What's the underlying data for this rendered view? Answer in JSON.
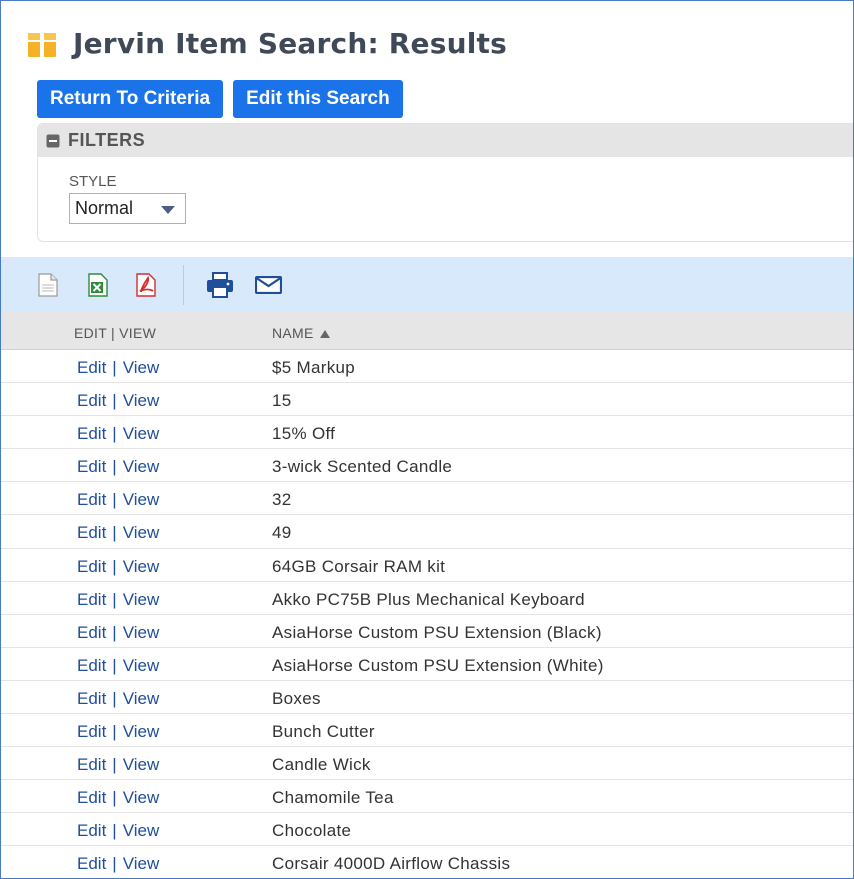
{
  "page": {
    "title": "Jervin Item Search: Results",
    "buttons": {
      "return_to_criteria": "Return To Criteria",
      "edit_this_search": "Edit this Search"
    }
  },
  "filters": {
    "label": "FILTERS",
    "style_label": "STYLE",
    "style_value": "Normal"
  },
  "toolbar": {
    "icons": [
      "export-csv-icon",
      "export-excel-icon",
      "export-pdf-icon",
      "print-icon",
      "email-icon"
    ]
  },
  "table": {
    "columns": {
      "edit_view": "EDIT | VIEW",
      "name": "NAME"
    },
    "sort": {
      "column": "name",
      "direction": "ascending"
    },
    "link_labels": {
      "edit": "Edit",
      "separator": "|",
      "view": "View"
    },
    "rows": [
      "$5 Markup",
      "15",
      "15% Off",
      "3-wick Scented Candle",
      "32",
      "49",
      "64GB Corsair RAM kit",
      "Akko PC75B Plus Mechanical Keyboard",
      "AsiaHorse Custom PSU Extension (Black)",
      "AsiaHorse Custom PSU Extension (White)",
      "Boxes",
      "Bunch Cutter",
      "Candle Wick",
      "Chamomile Tea",
      "Chocolate",
      "Corsair 4000D Airflow Chassis"
    ]
  },
  "colors": {
    "button_bg": "#1a73e8",
    "link": "#1f4e9a",
    "toolbar_bg": "#d7e9fb",
    "title": "#3f4958"
  }
}
